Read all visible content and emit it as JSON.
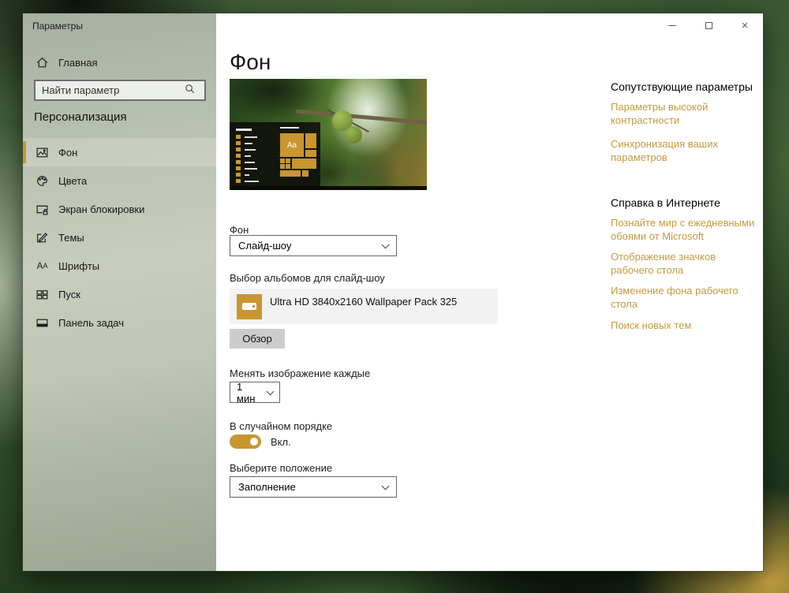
{
  "window": {
    "title": "Параметры"
  },
  "sidebar": {
    "home": {
      "label": "Главная"
    },
    "search": {
      "placeholder": "Найти параметр"
    },
    "section_title": "Персонализация",
    "items": [
      {
        "label": "Фон"
      },
      {
        "label": "Цвета"
      },
      {
        "label": "Экран блокировки"
      },
      {
        "label": "Темы"
      },
      {
        "label": "Шрифты"
      },
      {
        "label": "Пуск"
      },
      {
        "label": "Панель задач"
      }
    ]
  },
  "main": {
    "page_title": "Фон",
    "preview_tile_text": "Aa",
    "background": {
      "label": "Фон",
      "value": "Слайд-шоу"
    },
    "album": {
      "label": "Выбор альбомов для слайд-шоу",
      "name": "Ultra HD 3840x2160 Wallpaper Pack 325",
      "browse": "Обзор"
    },
    "interval": {
      "label": "Менять изображение каждые",
      "value": "1 мин"
    },
    "shuffle": {
      "label": "В случайном порядке",
      "state": "Вкл."
    },
    "fit": {
      "label": "Выберите положение",
      "value": "Заполнение"
    }
  },
  "related": {
    "title": "Сопутствующие параметры",
    "links": [
      {
        "label": "Параметры высокой контрастности"
      },
      {
        "label": "Синхронизация ваших параметров"
      }
    ]
  },
  "help": {
    "title": "Справка в Интернете",
    "links": [
      {
        "label": "Познайте мир с ежедневными обоями от Microsoft"
      },
      {
        "label": "Отображение значков рабочего стола"
      },
      {
        "label": "Изменение фона рабочего стола"
      },
      {
        "label": "Поиск новых тем"
      }
    ]
  },
  "colors": {
    "accent": "#C9962F",
    "link": "#C49A40"
  }
}
